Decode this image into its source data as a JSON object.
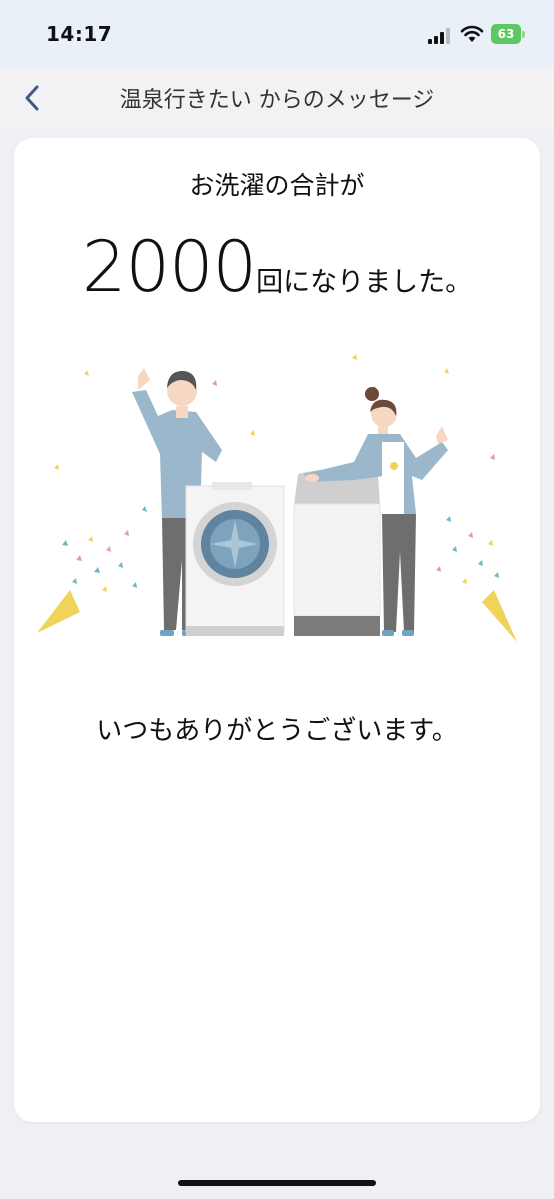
{
  "status_bar": {
    "time": "14:17",
    "battery": "63"
  },
  "nav": {
    "title": "温泉行きたい からのメッセージ"
  },
  "message": {
    "headline": "お洗濯の合計が",
    "count": "2000",
    "count_suffix": "回になりました。",
    "thanks": "いつもありがとうございます。"
  },
  "colors": {
    "accent": "#3d5a80",
    "clothing_blue": "#9bb7cc",
    "pants_gray": "#6e6e6e",
    "confetti_yellow": "#f0d35a",
    "confetti_teal": "#6fb6c9",
    "confetti_pink": "#e79aa7"
  }
}
